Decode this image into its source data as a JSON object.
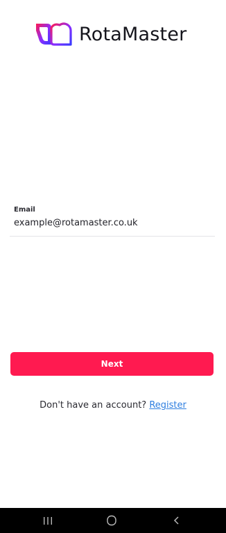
{
  "brand": {
    "name": "RotaMaster",
    "logo_icon": "rotamaster-logo-icon",
    "gradient": [
      "#ff1a50",
      "#7a2cff",
      "#3a3aff"
    ]
  },
  "email_field": {
    "label": "Email",
    "value": "example@rotamaster.co.uk"
  },
  "actions": {
    "next_label": "Next",
    "register_prompt": "Don't have an account?",
    "register_link": "Register"
  },
  "colors": {
    "primary": "#ff1a50",
    "link": "#2f7fe0",
    "navbar": "#000000"
  },
  "system_nav": {
    "recent_icon": "recent-apps-icon",
    "home_icon": "home-icon",
    "back_icon": "back-icon"
  }
}
